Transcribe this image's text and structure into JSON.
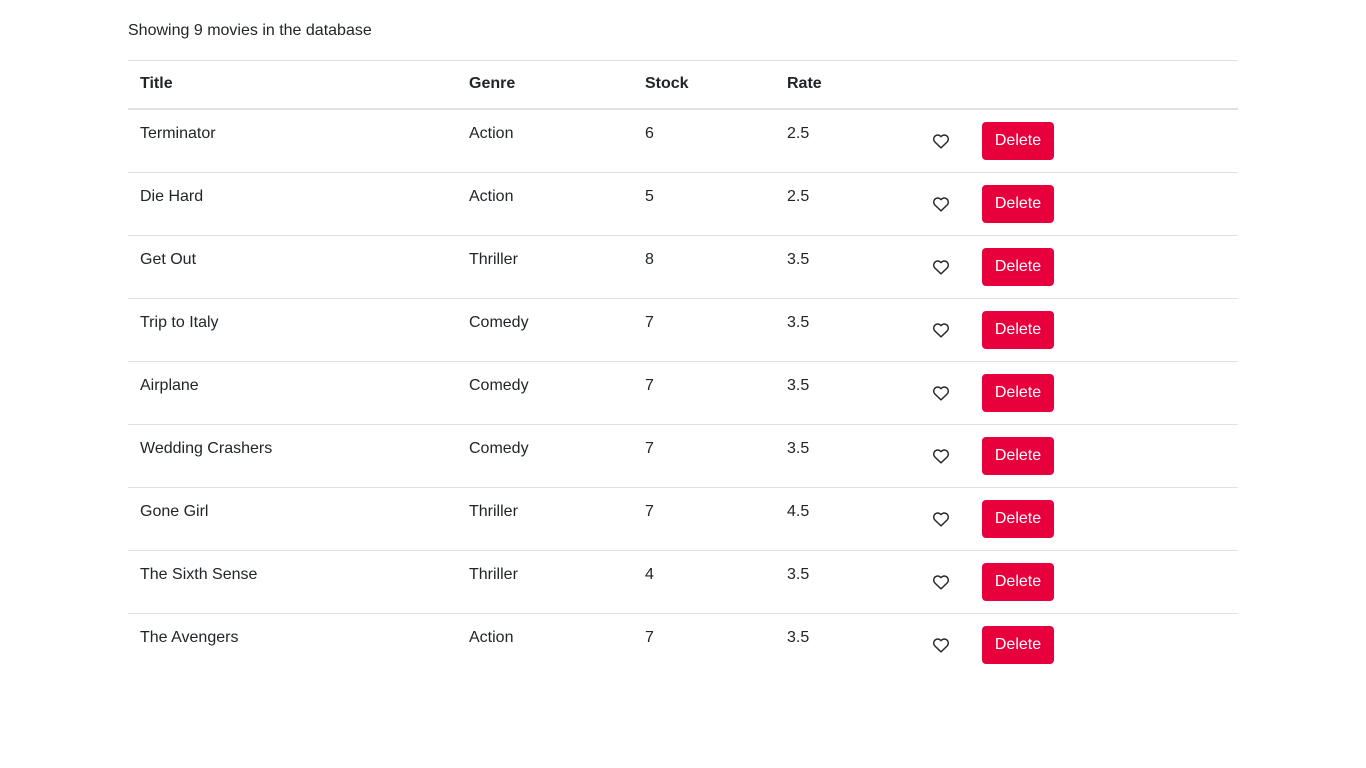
{
  "summary": {
    "prefix": "Showing",
    "count": "9",
    "suffix": "movies in the database"
  },
  "table": {
    "columns": [
      "Title",
      "Genre",
      "Stock",
      "Rate",
      ""
    ],
    "rows": [
      {
        "title": "Terminator",
        "genre": "Action",
        "stock": "6",
        "rate": "2.5",
        "liked": false
      },
      {
        "title": "Die Hard",
        "genre": "Action",
        "stock": "5",
        "rate": "2.5",
        "liked": false
      },
      {
        "title": "Get Out",
        "genre": "Thriller",
        "stock": "8",
        "rate": "3.5",
        "liked": false
      },
      {
        "title": "Trip to Italy",
        "genre": "Comedy",
        "stock": "7",
        "rate": "3.5",
        "liked": false
      },
      {
        "title": "Airplane",
        "genre": "Comedy",
        "stock": "7",
        "rate": "3.5",
        "liked": false
      },
      {
        "title": "Wedding Crashers",
        "genre": "Comedy",
        "stock": "7",
        "rate": "3.5",
        "liked": false
      },
      {
        "title": "Gone Girl",
        "genre": "Thriller",
        "stock": "7",
        "rate": "4.5",
        "liked": false
      },
      {
        "title": "The Sixth Sense",
        "genre": "Thriller",
        "stock": "4",
        "rate": "3.5",
        "liked": false
      },
      {
        "title": "The Avengers",
        "genre": "Action",
        "stock": "7",
        "rate": "3.5",
        "liked": false
      }
    ],
    "like_icon": "heart-outline-icon",
    "delete_label": "Delete"
  },
  "colors": {
    "delete_button": "#e8003d",
    "text": "#212529",
    "border": "#dee2e6"
  }
}
